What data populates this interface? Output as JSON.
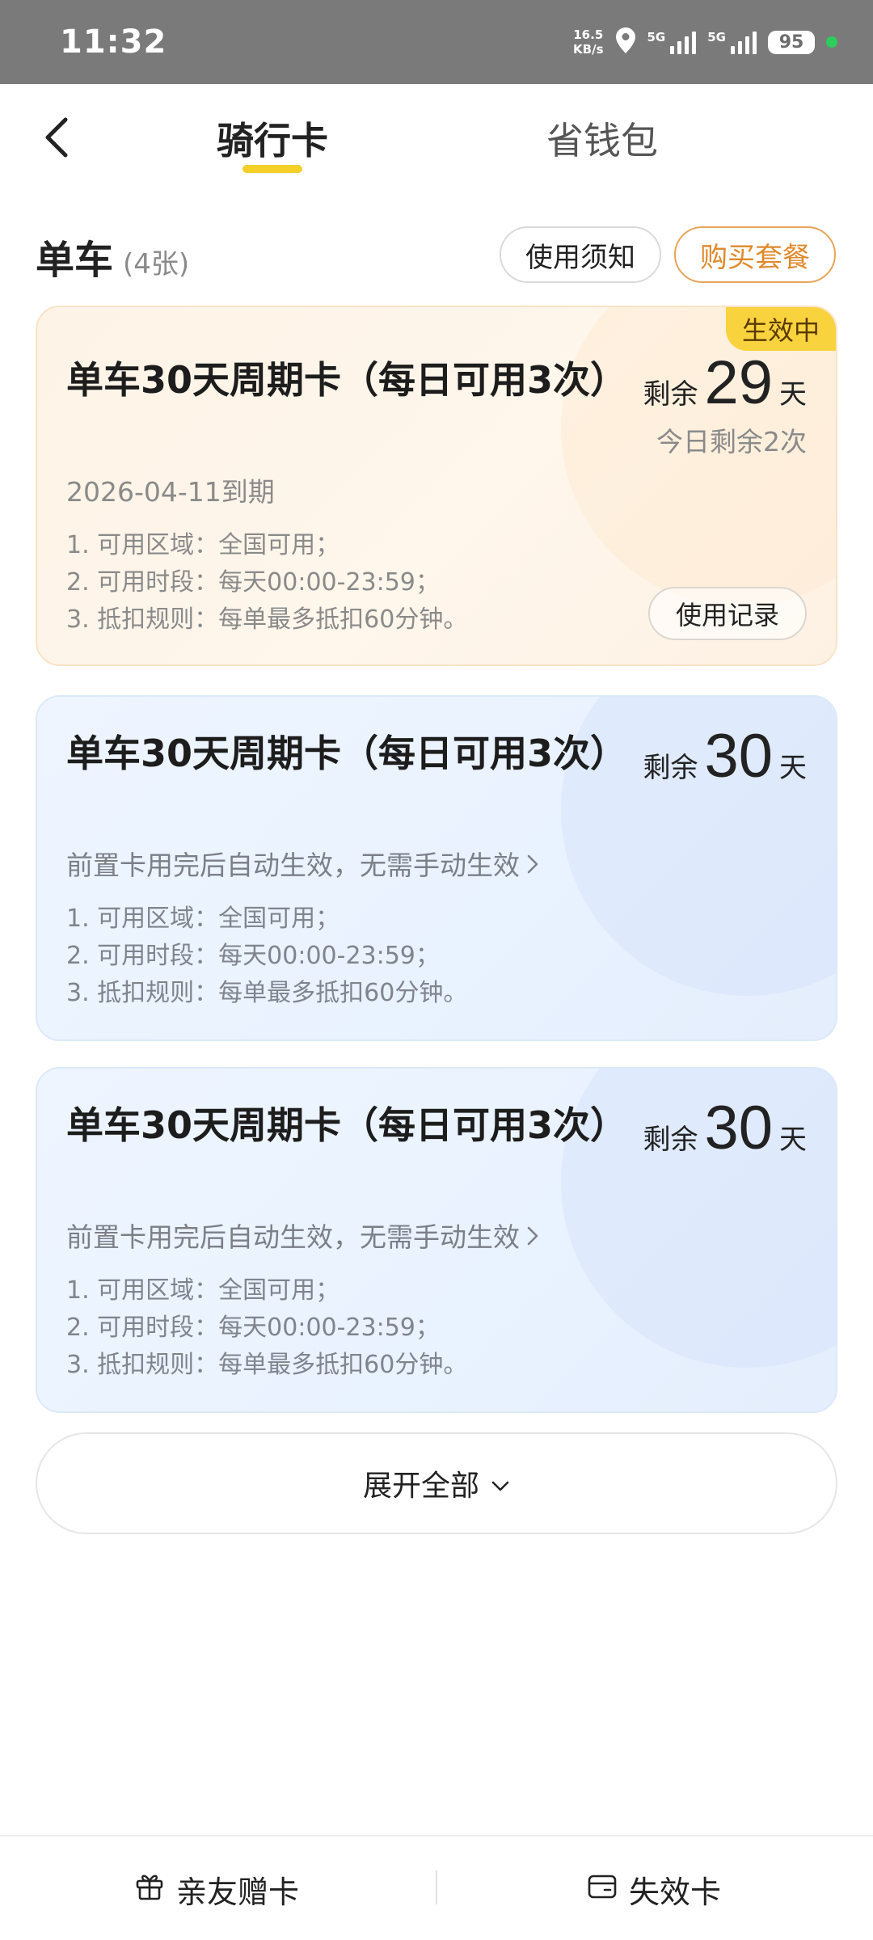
{
  "status_bar": {
    "time": "11:32",
    "net_speed_value": "16.5",
    "net_speed_unit": "KB/s",
    "signal1_label": "5G",
    "signal2_label": "5G",
    "battery": "95"
  },
  "nav": {
    "tab_active": "骑行卡",
    "tab_inactive": "省钱包"
  },
  "section": {
    "title": "单车",
    "count": "(4张)",
    "notice_button": "使用须知",
    "buy_button": "购买套餐"
  },
  "cards": [
    {
      "title": "单车30天周期卡（每日可用3次）",
      "subtitle": "2026-04-11到期",
      "badge": "生效中",
      "remain_label": "剩余",
      "remain_days": "29",
      "remain_unit": "天",
      "today_left": "今日剩余2次",
      "rules": [
        "1. 可用区域：全国可用；",
        "2. 可用时段：每天00:00-23:59；",
        "3. 抵扣规则：每单最多抵扣60分钟。"
      ],
      "record_button": "使用记录"
    },
    {
      "title": "单车30天周期卡（每日可用3次）",
      "subtitle": "前置卡用完后自动生效，无需手动生效",
      "remain_label": "剩余",
      "remain_days": "30",
      "remain_unit": "天",
      "rules": [
        "1. 可用区域：全国可用；",
        "2. 可用时段：每天00:00-23:59；",
        "3. 抵扣规则：每单最多抵扣60分钟。"
      ]
    },
    {
      "title": "单车30天周期卡（每日可用3次）",
      "subtitle": "前置卡用完后自动生效，无需手动生效",
      "remain_label": "剩余",
      "remain_days": "30",
      "remain_unit": "天",
      "rules": [
        "1. 可用区域：全国可用；",
        "2. 可用时段：每天00:00-23:59；",
        "3. 抵扣规则：每单最多抵扣60分钟。"
      ]
    }
  ],
  "expand_button": "展开全部",
  "bottom_bar": {
    "gift_label": "亲友赠卡",
    "expired_label": "失效卡"
  },
  "colors": {
    "accent_yellow": "#f8d33d",
    "buy_orange": "#e0892c",
    "card_orange_bg": "#fdf3e6",
    "card_blue_bg": "#eef5ff"
  }
}
